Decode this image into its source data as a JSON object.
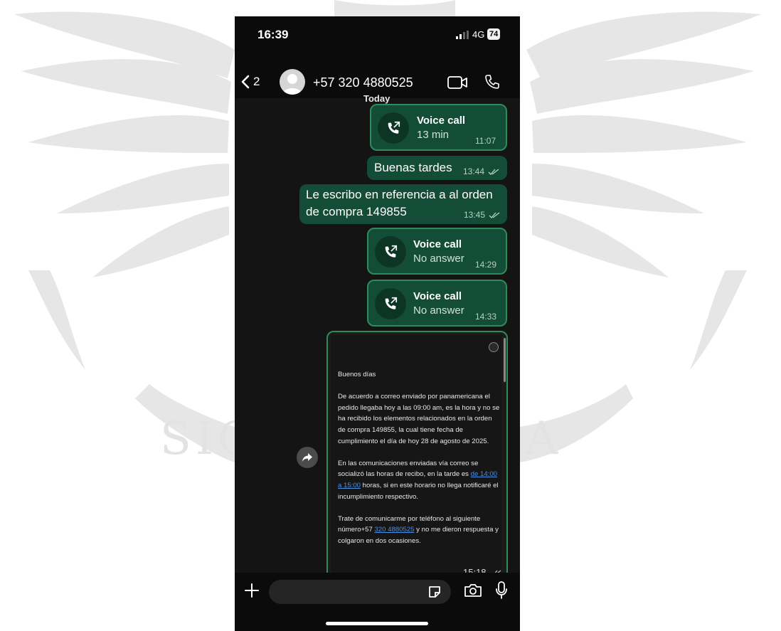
{
  "status_bar": {
    "time": "16:39",
    "network": "4G",
    "battery": "74"
  },
  "header": {
    "back_count": "2",
    "contact": "+57 320 4880525"
  },
  "chat": {
    "day_separator": "Today",
    "messages": [
      {
        "type": "call",
        "title": "Voice call",
        "subtitle": "13 min",
        "time": "11:07"
      },
      {
        "type": "text",
        "text": "Buenas tardes",
        "time": "13:44"
      },
      {
        "type": "text",
        "line1": "Le escribo en referencia a al orden",
        "line2": "de compra 149855",
        "time": "13:45"
      },
      {
        "type": "call",
        "title": "Voice call",
        "subtitle": "No answer",
        "time": "14:29"
      },
      {
        "type": "call",
        "title": "Voice call",
        "subtitle": "No answer",
        "time": "14:33"
      }
    ],
    "email_image": {
      "greeting": "Buenos días",
      "para1": "De acuerdo a correo enviado por panamericana el pedido llegaba hoy a las 09:00 am, es la hora y no se ha recibido los elementos relacionados en la orden de compra 149855, la cual tiene fecha de cumplimiento el día de hoy 28 de agosto de 2025.",
      "para2_before": "En las comunicaciones enviadas vía correo se socializó las horas de recibo, en la tarde es ",
      "para2_link": "de 14:00 a 15:00",
      "para2_after": " horas, si en este horario no llega notificaré el incumplimiento respectivo.",
      "para3_before": "Trate de comunicarme por teléfono al siguiente número+57 ",
      "para3_link": "320 4880525",
      "para3_after": " y no me dieron respuesta y colgaron en dos ocasiones.",
      "time": "15:18"
    }
  },
  "input": {
    "placeholder": ""
  },
  "watermark": {
    "text_left": "SIC",
    "text_right": "A"
  },
  "colors": {
    "bubble_out": "#144d37",
    "bubble_border": "#2f8a5e",
    "background": "#0b0b0b",
    "link": "#4a8fe0"
  }
}
